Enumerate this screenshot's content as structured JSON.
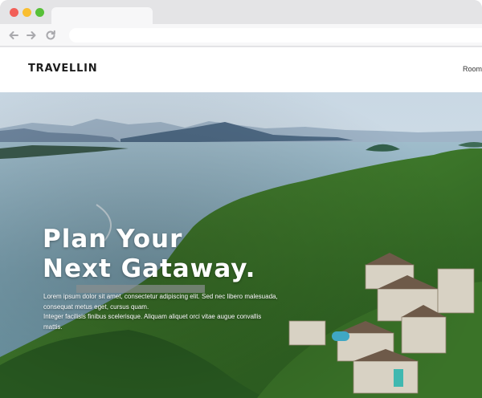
{
  "browser": {
    "buttons": [
      "close",
      "minimize",
      "maximize"
    ],
    "nav_icons": [
      "back-arrow-icon",
      "forward-arrow-icon",
      "reload-icon"
    ]
  },
  "header": {
    "logo": "TRAVELLIN",
    "nav_visible": "Room"
  },
  "hero": {
    "title_line1": "Plan Your",
    "title_line2": "Next Gataway.",
    "paragraph_line1": "Lorem ipsum dolor sit amet, consectetur adipiscing elit. Sed nec libero malesuada, consequat metus eget, cursus quam.",
    "paragraph_line2": "Integer facilisis finibus scelerisque. Aliquam aliquet orci vitae augue convallis mattis."
  },
  "colors": {
    "close": "#f25f58",
    "minimize": "#f9be30",
    "maximize": "#57c038",
    "sea": "#7fa6b6",
    "forest": "#3d7a2c"
  }
}
